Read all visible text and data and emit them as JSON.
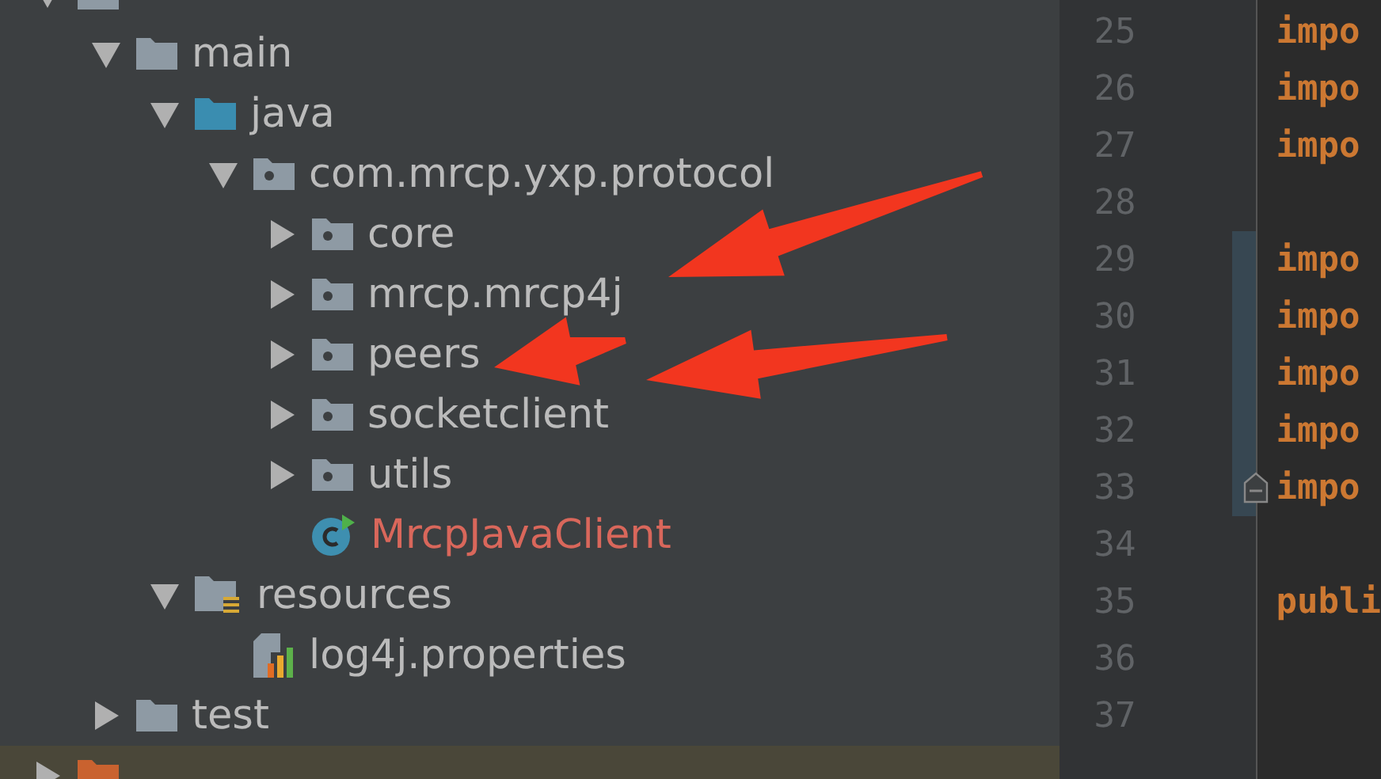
{
  "project_tree": [
    {
      "kind": "folder",
      "expanded": true,
      "children": [
        {
          "label": "main",
          "kind": "folder",
          "expanded": true,
          "children": [
            {
              "label": "java",
              "kind": "source-folder",
              "expanded": true,
              "children": [
                {
                  "label": "com.mrcp.yxp.protocol",
                  "kind": "package",
                  "expanded": true,
                  "children": [
                    {
                      "label": "core",
                      "kind": "package",
                      "expanded": false
                    },
                    {
                      "label": "mrcp.mrcp4j",
                      "kind": "package",
                      "expanded": false
                    },
                    {
                      "label": "peers",
                      "kind": "package",
                      "expanded": false
                    },
                    {
                      "label": "socketclient",
                      "kind": "package",
                      "expanded": false
                    },
                    {
                      "label": "utils",
                      "kind": "package",
                      "expanded": false
                    },
                    {
                      "label": "MrcpJavaClient",
                      "kind": "class"
                    }
                  ]
                }
              ]
            },
            {
              "label": "resources",
              "kind": "resource-folder",
              "expanded": true,
              "children": [
                {
                  "label": "log4j.properties",
                  "kind": "properties-file"
                }
              ]
            }
          ]
        },
        {
          "label": "test",
          "kind": "folder",
          "expanded": false
        }
      ]
    },
    {
      "kind": "excluded-folder",
      "expanded": false
    }
  ],
  "editor": {
    "lines": [
      {
        "number": "25",
        "code": "impo"
      },
      {
        "number": "26",
        "code": "impo"
      },
      {
        "number": "27",
        "code": "impo"
      },
      {
        "number": "28"
      },
      {
        "number": "29",
        "code": "impo",
        "changed": true
      },
      {
        "number": "30",
        "code": "impo",
        "changed": true
      },
      {
        "number": "31",
        "code": "impo",
        "changed": true
      },
      {
        "number": "32",
        "code": "impo",
        "changed": true
      },
      {
        "number": "33",
        "code": "impo",
        "changed": true,
        "fold": true
      },
      {
        "number": "34"
      },
      {
        "number": "35",
        "code": "publi"
      },
      {
        "number": "36"
      },
      {
        "number": "37"
      }
    ]
  },
  "annotations": [
    {
      "kind": "arrow"
    },
    {
      "kind": "arrow"
    },
    {
      "kind": "arrow"
    }
  ]
}
